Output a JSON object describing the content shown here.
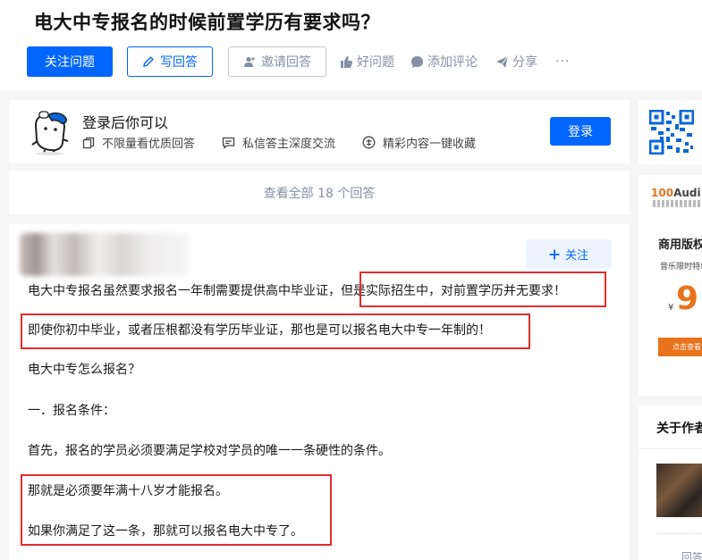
{
  "question": {
    "title": "电大中专报名的时候前置学历有要求吗？",
    "actions": {
      "follow": "关注问题",
      "write": "写回答",
      "invite": "邀请回答",
      "good": "好问题",
      "comment": "添加评论",
      "share": "分享",
      "more": "···"
    }
  },
  "login": {
    "title": "登录后你可以",
    "perks": [
      "不限量看优质回答",
      "私信答主深度交流",
      "精彩内容一键收藏"
    ],
    "button": "登录"
  },
  "view_all": "查看全部 18 个回答",
  "answer": {
    "follow": "关注",
    "paragraphs": [
      "电大中专报名虽然要求报名一年制需要提供高中毕业证，但是实际招生中，对前置学历并无要求！",
      "即使你初中毕业，或者压根都没有学历毕业证，那也是可以报名电大中专一年制的！",
      "电大中专怎么报名？",
      "一．报名条件：",
      "首先，报名的学员必须要满足学校对学员的唯一一条硬性的条件。",
      "那就是必须要年满十八岁才能报名。",
      "如果你满足了这一条，那就可以报名电大中专了。"
    ]
  },
  "sidebar": {
    "ad": {
      "brand_a": "100",
      "brand_b": "Audi",
      "title": "商用版权",
      "subtitle": "音乐限时特惠",
      "currency": "¥",
      "price": "9",
      "button": "点击查看"
    },
    "about_title": "关于作者",
    "more": "回答"
  },
  "colors": {
    "primary": "#0066ff",
    "highlight": "#e02d2d",
    "ad_accent": "#e8731c"
  }
}
